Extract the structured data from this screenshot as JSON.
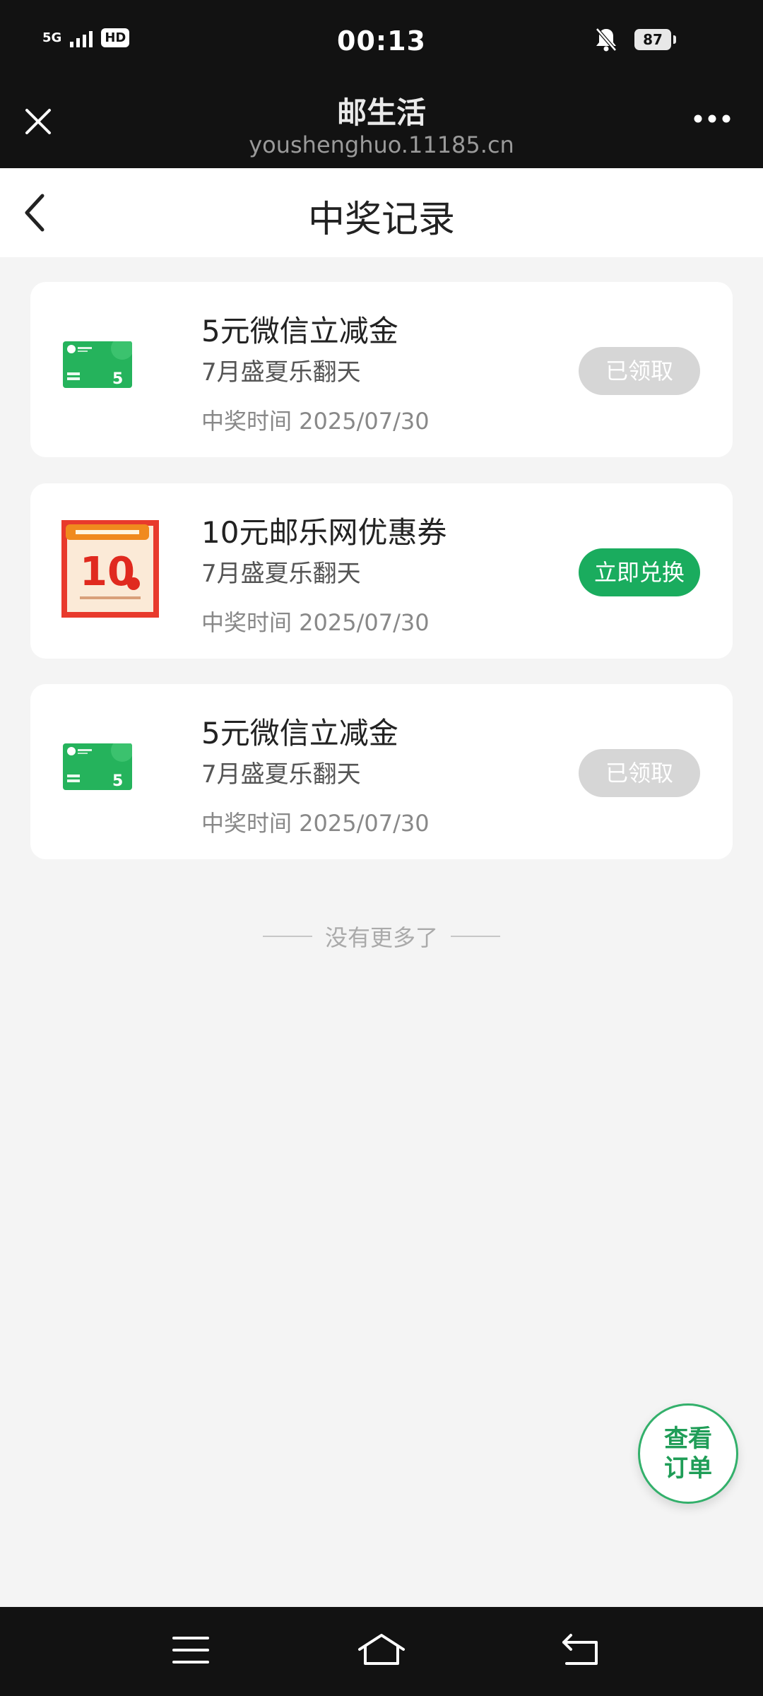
{
  "status_bar": {
    "network": "5G",
    "hd": "HD",
    "time": "00:13",
    "battery": "87",
    "icons": [
      "signal-icon",
      "bell-muted-icon",
      "battery-icon"
    ]
  },
  "app_bar": {
    "title": "邮生活",
    "url": "youshenghuo.11185.cn",
    "icons": [
      "close-icon",
      "more-icon"
    ]
  },
  "page": {
    "title": "中奖记录"
  },
  "records": [
    {
      "title": "5元微信立减金",
      "campaign": "7月盛夏乐翻天",
      "time": "中奖时间 2025/07/30",
      "button": "已领取",
      "button_state": "claimed",
      "thumb": "wechat-coupon-icon",
      "thumb_value": "5"
    },
    {
      "title": "10元邮乐网优惠券",
      "campaign": "7月盛夏乐翻天",
      "time": "中奖时间 2025/07/30",
      "button": "立即兑换",
      "button_state": "redeem",
      "thumb": "youle-coupon-icon",
      "thumb_value": "10"
    },
    {
      "title": "5元微信立减金",
      "campaign": "7月盛夏乐翻天",
      "time": "中奖时间 2025/07/30",
      "button": "已领取",
      "button_state": "claimed",
      "thumb": "wechat-coupon-icon",
      "thumb_value": "5"
    }
  ],
  "no_more": "没有更多了",
  "fab": {
    "line1": "查看",
    "line2": "订单"
  },
  "nav_bar": {
    "icons": [
      "menu-icon",
      "home-icon",
      "back-nav-icon"
    ]
  },
  "colors": {
    "accent": "#1aac5e",
    "claimed": "#d6d6d6",
    "bar": "#121212",
    "background": "#f4f4f4"
  }
}
